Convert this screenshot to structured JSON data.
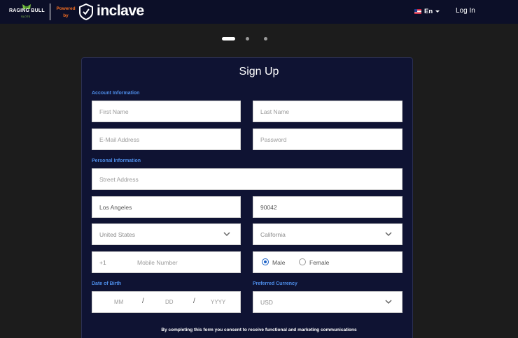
{
  "header": {
    "brand_name": "RAGING BULL",
    "brand_sub": "SLOTS",
    "powered_by": "Powered by",
    "partner_name": "inclave",
    "language": "En",
    "login_label": "Log In"
  },
  "carousel": {
    "total": 3,
    "active": 1
  },
  "form": {
    "title": "Sign Up",
    "sections": {
      "account": "Account Information",
      "personal": "Personal Information",
      "dob": "Date of Birth",
      "currency": "Preferred Currency"
    },
    "placeholders": {
      "first_name": "First Name",
      "last_name": "Last Name",
      "email": "E-Mail Address",
      "password": "Password",
      "street": "Street Address",
      "mobile": "Mobile Number"
    },
    "values": {
      "city": "Los Angeles",
      "zip": "90042",
      "country": "United States",
      "state": "California",
      "phone_prefix": "+1",
      "currency": "USD"
    },
    "gender": {
      "male": "Male",
      "female": "Female",
      "selected": "male"
    },
    "dob": {
      "month": "MM",
      "day": "DD",
      "year": "YYYY",
      "separator": "/"
    },
    "consent": "By completing this form you consent to receive functional and marketing communications"
  },
  "colors": {
    "header_bg": "#0c0f28",
    "card_bg": "#0f1333",
    "section_label": "#4e8eea",
    "accent_orange": "#f36d21",
    "radio_selected": "#1c62c7"
  }
}
